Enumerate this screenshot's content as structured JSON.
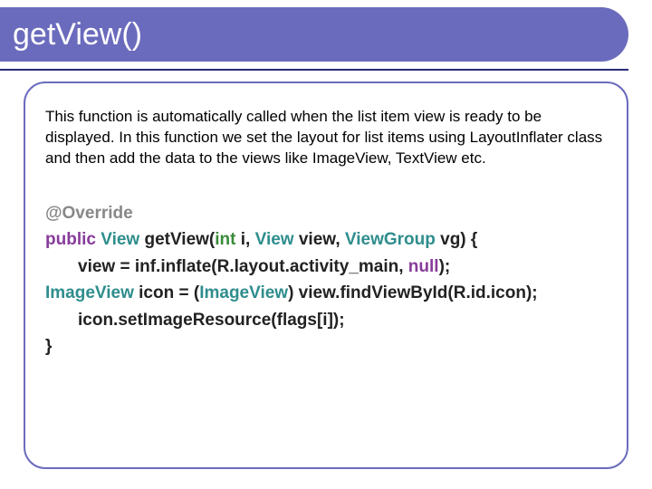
{
  "header": {
    "title": "getView()"
  },
  "description": "This function is automatically called when the list item view is ready to be displayed. In this function we set the layout for list items using LayoutInflater class and then add the data to the views like ImageView, TextView etc.",
  "code": {
    "annotation": "@Override",
    "kw_public": "public",
    "type_view": "View",
    "method_name": " getView(",
    "kw_int": "int",
    "param_i": " i, ",
    "type_view2": "View",
    "param_view": " view, ",
    "type_viewgroup": "ViewGroup",
    "param_vg": " vg) {",
    "line_inflate_a": "view = inf.inflate(R.layout.activity_main, ",
    "kw_null": "null",
    "line_inflate_b": ");",
    "line_imgv_a": "ImageView",
    "line_imgv_b": " icon = (",
    "line_imgv_c": "ImageView",
    "line_imgv_d": ") view.findViewById(R.id.icon);",
    "line_seticon": "icon.setImageResource(flags[i]);",
    "close_brace": "}"
  }
}
